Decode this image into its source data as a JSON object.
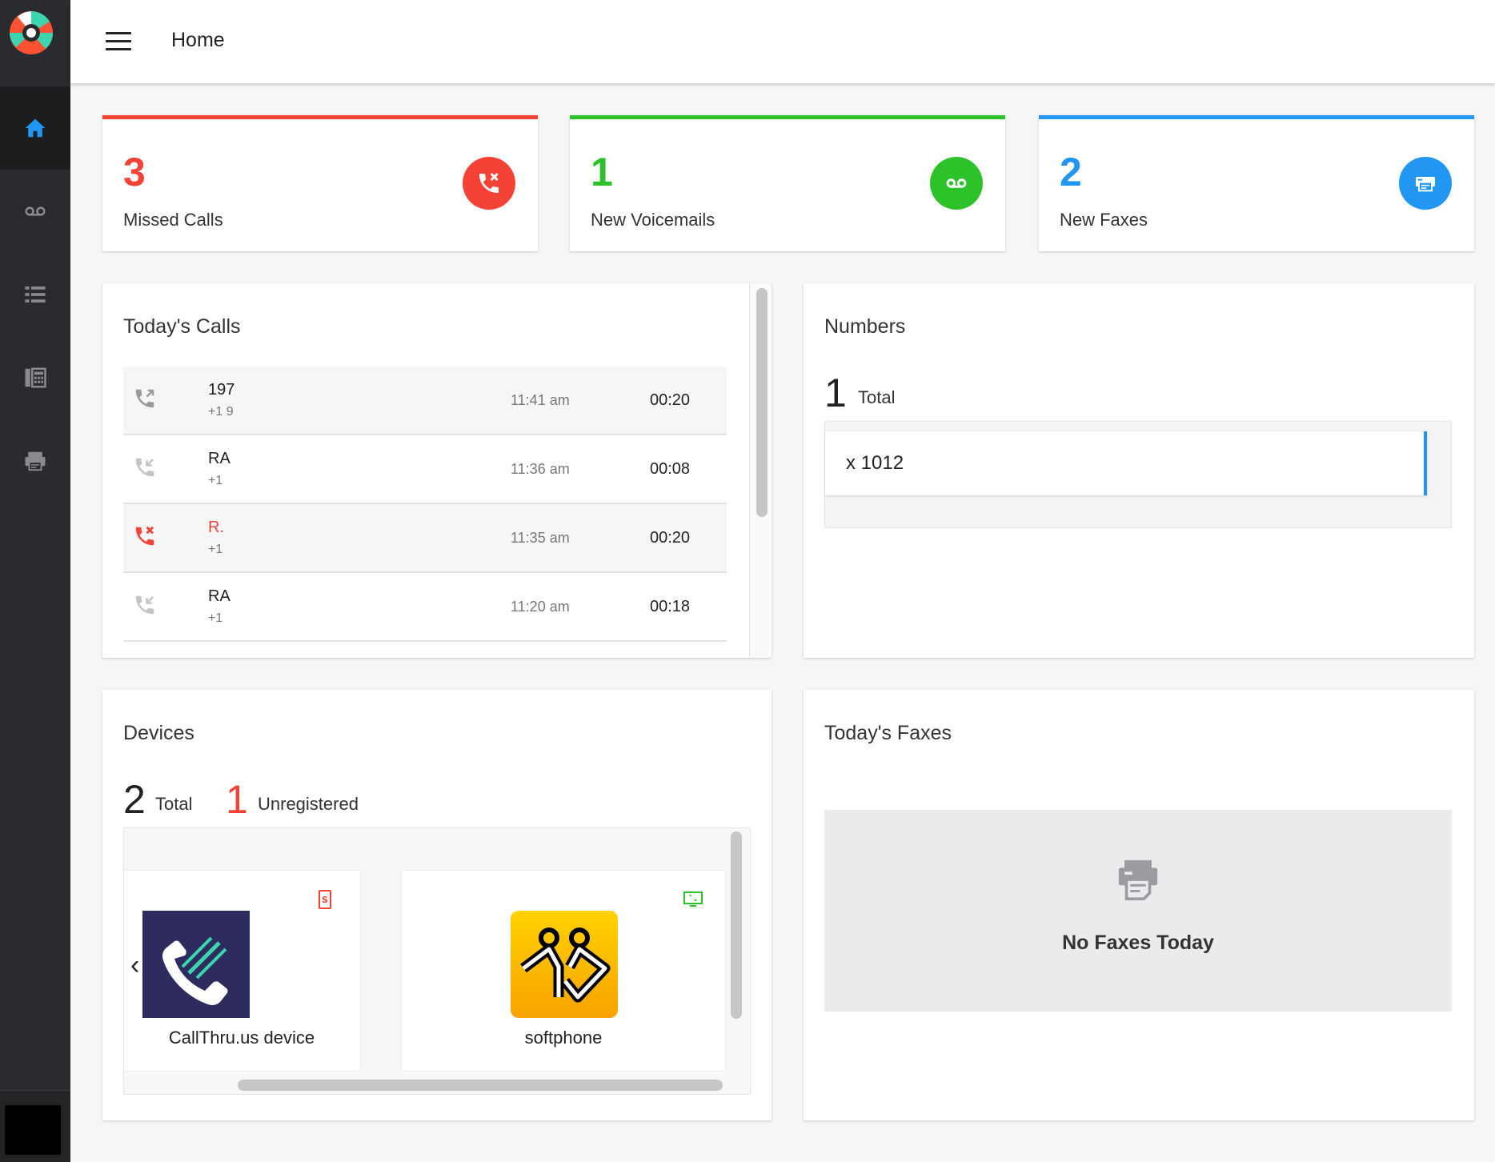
{
  "header": {
    "title": "Home"
  },
  "sidebar": {
    "items": [
      {
        "icon": "home-icon",
        "active": true
      },
      {
        "icon": "voicemail-icon"
      },
      {
        "icon": "list-icon"
      },
      {
        "icon": "phone-keypad-icon"
      },
      {
        "icon": "fax-icon"
      }
    ]
  },
  "stats": {
    "missed": {
      "count": "3",
      "label": "Missed Calls",
      "color": "#f44336"
    },
    "voicemails": {
      "count": "1",
      "label": "New Voicemails",
      "color": "#2ec22a"
    },
    "faxes": {
      "count": "2",
      "label": "New Faxes",
      "color": "#2196f3"
    }
  },
  "calls": {
    "title": "Today's Calls",
    "rows": [
      {
        "type": "outgoing",
        "name": "197",
        "number": "+1 9",
        "time": "11:41 am",
        "duration": "00:20"
      },
      {
        "type": "incoming",
        "name": "RA",
        "number": "+1",
        "time": "11:36 am",
        "duration": "00:08"
      },
      {
        "type": "missed",
        "name": "R.",
        "number": "+1",
        "time": "11:35 am",
        "duration": "00:20"
      },
      {
        "type": "incoming",
        "name": "RA",
        "number": "+1",
        "time": "11:20 am",
        "duration": "00:18"
      }
    ]
  },
  "numbers": {
    "title": "Numbers",
    "total": "1",
    "total_label": "Total",
    "items": [
      "x 1012"
    ]
  },
  "devices": {
    "title": "Devices",
    "total": "2",
    "total_label": "Total",
    "unregistered": "1",
    "unregistered_label": "Unregistered",
    "items": [
      {
        "label": "CallThru.us device"
      },
      {
        "label": "softphone"
      }
    ],
    "prev": "‹",
    "next": "›"
  },
  "faxes": {
    "title": "Today's Faxes",
    "empty": "No Faxes Today"
  }
}
